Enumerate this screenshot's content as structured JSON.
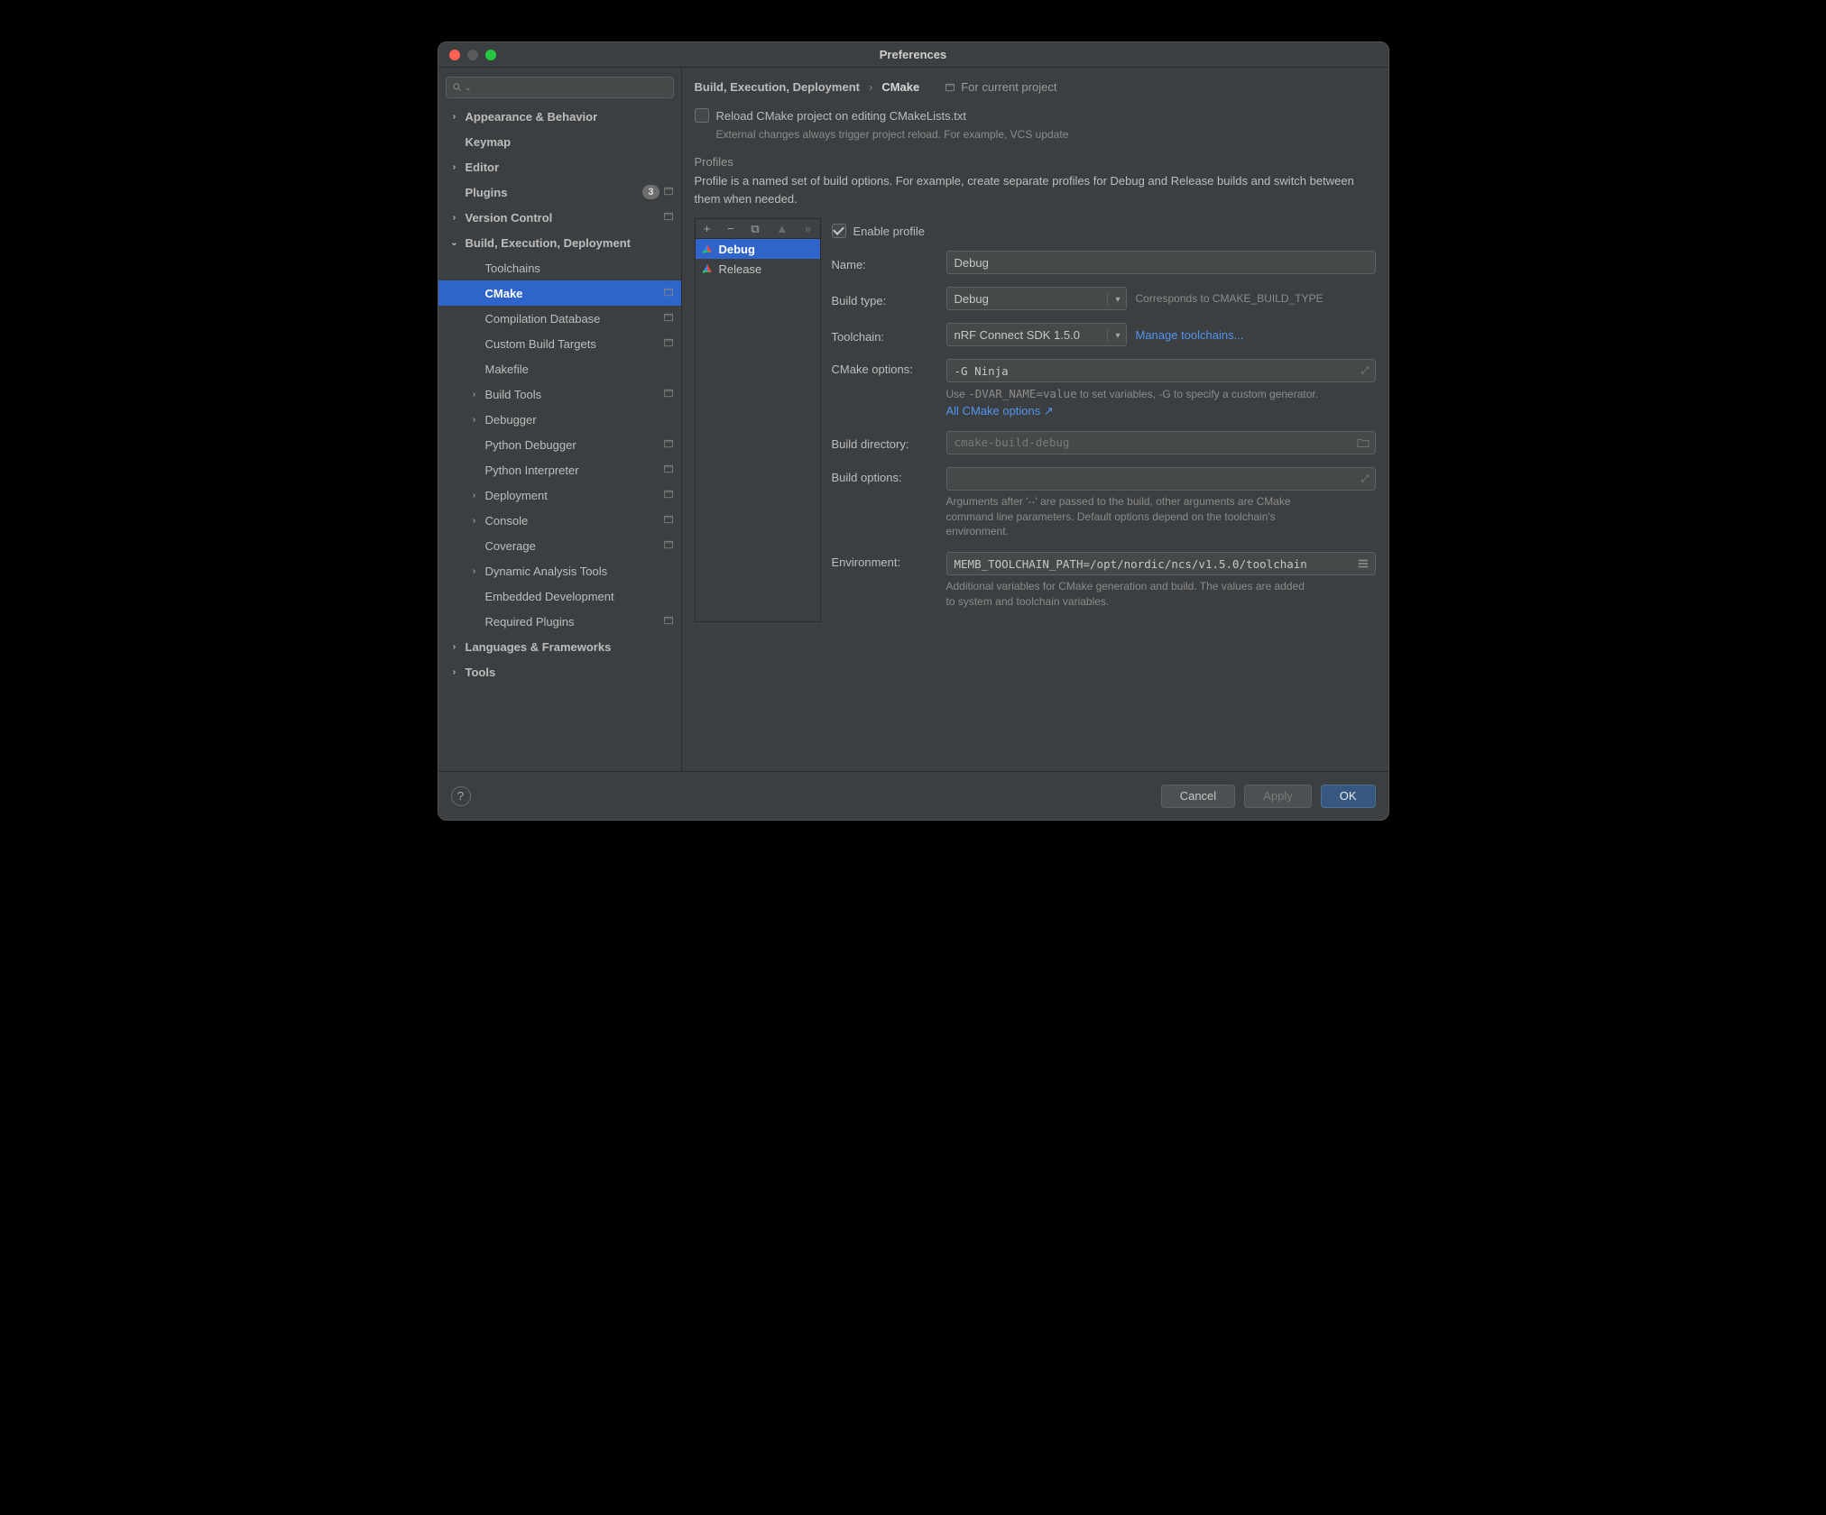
{
  "window": {
    "title": "Preferences"
  },
  "sidebar": {
    "search_placeholder": "",
    "items": [
      {
        "label": "Appearance & Behavior",
        "level": 1,
        "expandable": true,
        "expanded": false
      },
      {
        "label": "Keymap",
        "level": 1
      },
      {
        "label": "Editor",
        "level": 1,
        "expandable": true,
        "expanded": false
      },
      {
        "label": "Plugins",
        "level": 1,
        "badge": "3",
        "proj_icon": true
      },
      {
        "label": "Version Control",
        "level": 1,
        "expandable": true,
        "expanded": false,
        "proj_icon": true
      },
      {
        "label": "Build, Execution, Deployment",
        "level": 1,
        "expandable": true,
        "expanded": true
      },
      {
        "label": "Toolchains",
        "level": 2
      },
      {
        "label": "CMake",
        "level": 2,
        "selected": true,
        "proj_icon": true
      },
      {
        "label": "Compilation Database",
        "level": 2,
        "proj_icon": true
      },
      {
        "label": "Custom Build Targets",
        "level": 2,
        "proj_icon": true
      },
      {
        "label": "Makefile",
        "level": 2
      },
      {
        "label": "Build Tools",
        "level": 2,
        "expandable": true,
        "expanded": false,
        "proj_icon": true
      },
      {
        "label": "Debugger",
        "level": 2,
        "expandable": true,
        "expanded": false
      },
      {
        "label": "Python Debugger",
        "level": 2,
        "proj_icon": true
      },
      {
        "label": "Python Interpreter",
        "level": 2,
        "proj_icon": true
      },
      {
        "label": "Deployment",
        "level": 2,
        "expandable": true,
        "expanded": false,
        "proj_icon": true
      },
      {
        "label": "Console",
        "level": 2,
        "expandable": true,
        "expanded": false,
        "proj_icon": true
      },
      {
        "label": "Coverage",
        "level": 2,
        "proj_icon": true
      },
      {
        "label": "Dynamic Analysis Tools",
        "level": 2,
        "expandable": true,
        "expanded": false
      },
      {
        "label": "Embedded Development",
        "level": 2
      },
      {
        "label": "Required Plugins",
        "level": 2,
        "proj_icon": true
      },
      {
        "label": "Languages & Frameworks",
        "level": 1,
        "expandable": true,
        "expanded": false
      },
      {
        "label": "Tools",
        "level": 1,
        "expandable": true,
        "expanded": false
      }
    ]
  },
  "breadcrumb": {
    "parent": "Build, Execution, Deployment",
    "current": "CMake",
    "scope": "For current project"
  },
  "reload": {
    "label": "Reload CMake project on editing CMakeLists.txt",
    "checked": false,
    "help": "External changes always trigger project reload. For example, VCS update"
  },
  "profiles_section": {
    "title": "Profiles",
    "description": "Profile is a named set of build options. For example, create separate profiles for Debug and Release builds and switch between them when needed."
  },
  "profile_list": {
    "toolbar": {
      "add": "+",
      "remove": "−",
      "copy": "⧉",
      "up": "▲",
      "down": "»"
    },
    "items": [
      {
        "label": "Debug",
        "selected": true
      },
      {
        "label": "Release",
        "selected": false
      }
    ]
  },
  "form": {
    "enable": {
      "label": "Enable profile",
      "checked": true
    },
    "name": {
      "label": "Name:",
      "value": "Debug"
    },
    "build_type": {
      "label": "Build type:",
      "value": "Debug",
      "help": "Corresponds to CMAKE_BUILD_TYPE"
    },
    "toolchain": {
      "label": "Toolchain:",
      "value": "nRF Connect SDK 1.5.0",
      "link": "Manage toolchains..."
    },
    "cmake_options": {
      "label": "CMake options:",
      "value": "-G Ninja",
      "help_prefix": "Use ",
      "help_code": "-DVAR_NAME=value",
      "help_suffix": " to set variables, -G to specify a custom generator.",
      "link": "All CMake options ↗"
    },
    "build_dir": {
      "label": "Build directory:",
      "placeholder": "cmake-build-debug"
    },
    "build_options": {
      "label": "Build options:",
      "value": "",
      "help": "Arguments after '--' are passed to the build, other arguments are CMake command line parameters. Default options depend on the toolchain's environment."
    },
    "environment": {
      "label": "Environment:",
      "value": "MEMB_TOOLCHAIN_PATH=/opt/nordic/ncs/v1.5.0/toolchain",
      "help": "Additional variables for CMake generation and build. The values are added to system and toolchain variables."
    }
  },
  "footer": {
    "cancel": "Cancel",
    "apply": "Apply",
    "ok": "OK"
  }
}
